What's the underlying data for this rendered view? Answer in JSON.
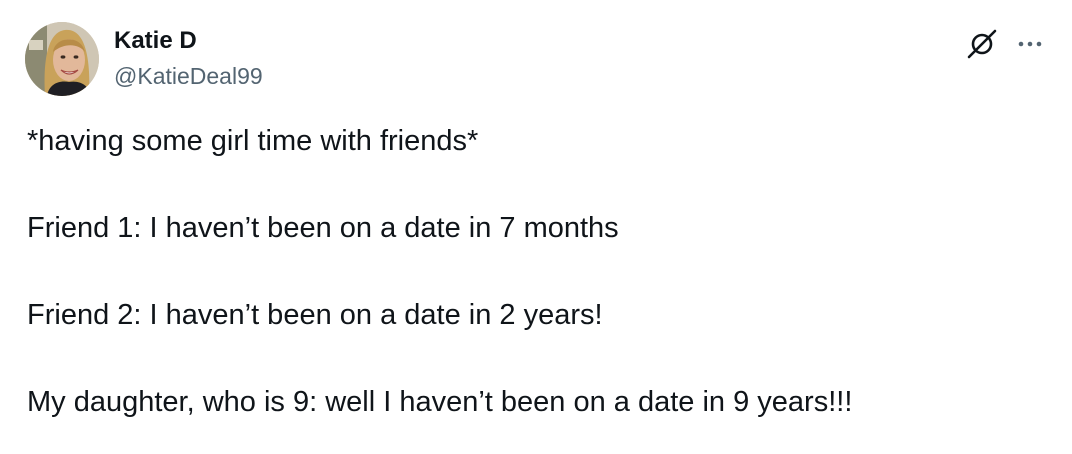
{
  "author": {
    "display_name": "Katie D",
    "handle": "@KatieDeal99"
  },
  "icons": {
    "avatar": "profile-photo",
    "grok": "grok-icon",
    "more": "more-options-icon"
  },
  "tweet": {
    "lines": [
      "*having some girl time with friends*",
      "Friend 1: I haven’t been on a date in 7 months",
      "Friend 2: I haven’t been on a date in 2 years!",
      "My daughter, who is 9: well I haven’t been on a date in 9 years!!!"
    ]
  },
  "colors": {
    "text": "#0f1419",
    "secondary": "#536471",
    "background": "#ffffff"
  }
}
